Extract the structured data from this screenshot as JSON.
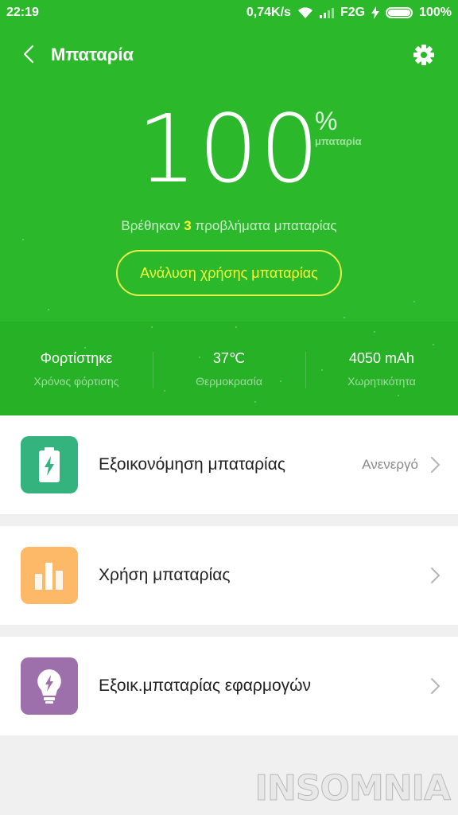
{
  "status_bar": {
    "time": "22:19",
    "speed": "0,74K/s",
    "network": "F2G",
    "battery": "100%"
  },
  "header": {
    "title": "Μπαταρία",
    "back_icon": "chevron-left-icon",
    "settings_icon": "gear-icon"
  },
  "battery": {
    "level": "100",
    "percent_sign": "%",
    "unit_label": "μπαταρία",
    "problems_prefix": "Βρέθηκαν",
    "problems_count": "3",
    "problems_suffix": "προβλήματα μπαταρίας",
    "analyze_label": "Ανάλυση χρήσης μπαταρίας"
  },
  "stats": [
    {
      "value": "Φορτίστηκε",
      "label": "Χρόνος φόρτισης"
    },
    {
      "value": "37℃",
      "label": "Θερμοκρασία"
    },
    {
      "value": "4050 mAh",
      "label": "Χωρητικότητα"
    }
  ],
  "menu": [
    {
      "label": "Εξοικονόμηση μπαταρίας",
      "status": "Ανενεργό",
      "icon": "battery-saver-icon",
      "color": "#35b37e"
    },
    {
      "label": "Χρήση μπαταρίας",
      "status": "",
      "icon": "bar-chart-icon",
      "color": "#fdb967"
    },
    {
      "label": "Εξοικ.μπαταρίας εφαρμογών",
      "status": "",
      "icon": "lightbulb-icon",
      "color": "#9d6fab"
    }
  ],
  "colors": {
    "primary_green": "#2bb92b",
    "highlight_yellow": "#f6ff3c"
  },
  "watermark": "INSOMNIA"
}
